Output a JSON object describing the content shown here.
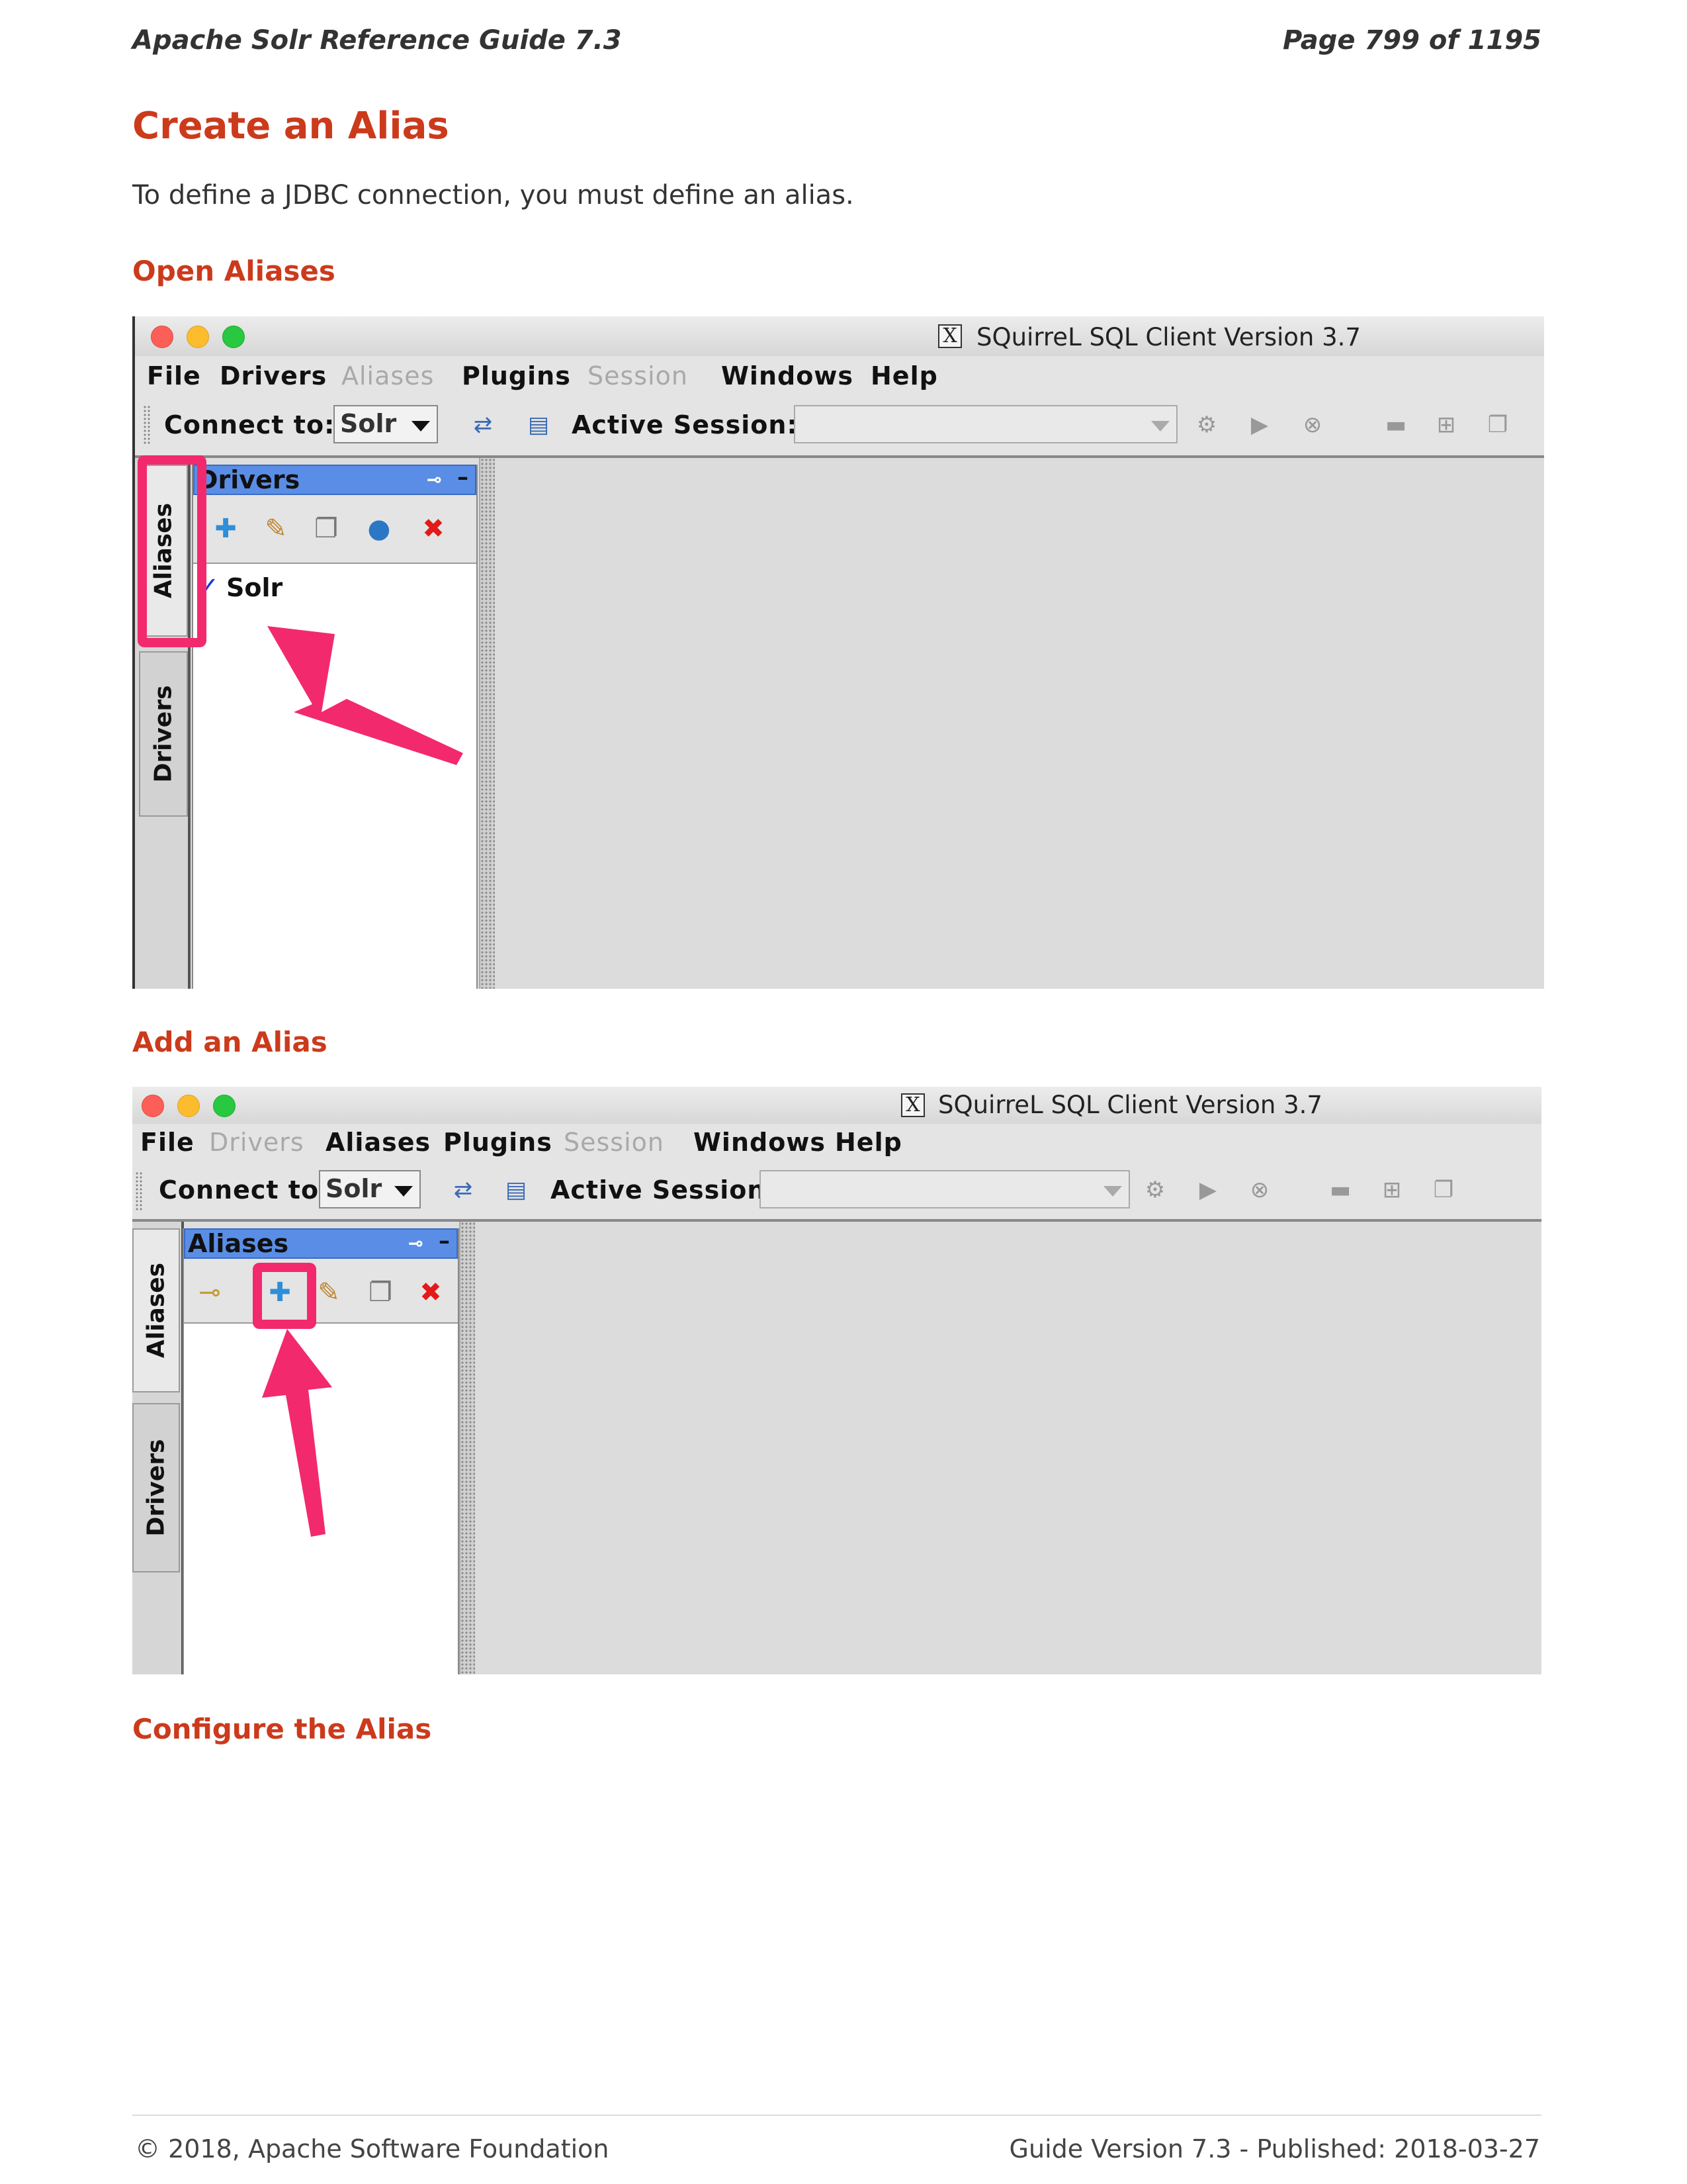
{
  "header": {
    "left": "Apache Solr Reference Guide 7.3",
    "right": "Page 799 of 1195"
  },
  "section_title": "Create an Alias",
  "intro": "To define a JDBC connection, you must define an alias.",
  "step1": {
    "heading": "Open Aliases"
  },
  "step2": {
    "heading": "Add an Alias"
  },
  "step3": {
    "heading": "Configure the Alias"
  },
  "app": {
    "window_title": "SQuirreL SQL Client Version 3.7",
    "x_icon": "X",
    "menus": {
      "file": "File",
      "drivers": "Drivers",
      "aliases": "Aliases",
      "plugins": "Plugins",
      "session": "Session",
      "windows": "Windows",
      "help": "Help"
    },
    "connect_to_label": "Connect to:",
    "connect_to_value": "Solr",
    "active_session_label": "Active Session:",
    "tab_aliases": "Aliases",
    "tab_drivers": "Drivers"
  },
  "shot1": {
    "panel_title": "Drivers",
    "driver_check": "✓",
    "driver_item": "Solr",
    "disabled_menus": [
      "Aliases",
      "Session"
    ]
  },
  "shot2": {
    "panel_title": "Aliases",
    "disabled_menus": [
      "Drivers",
      "Session"
    ]
  },
  "accent": {
    "heading": "#cc3a1c",
    "highlight": "#f3296e",
    "panel_title": "#5a8ee6"
  },
  "footer": {
    "left": "© 2018, Apache Software Foundation",
    "right": "Guide Version 7.3 - Published: 2018-03-27"
  }
}
